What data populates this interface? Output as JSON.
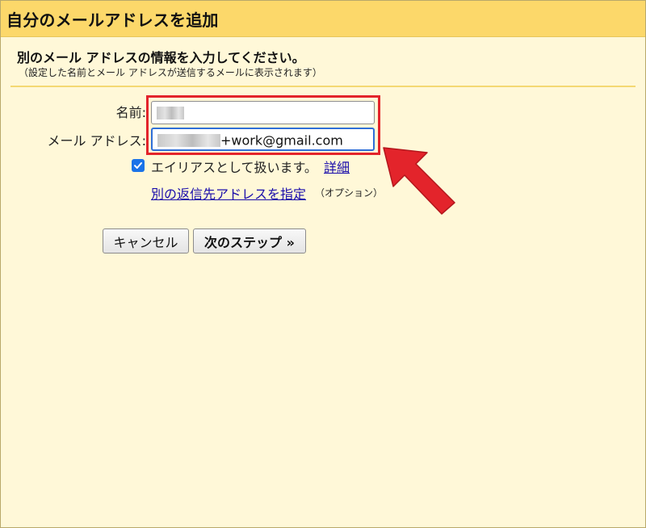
{
  "window": {
    "title": "自分のメールアドレスを追加"
  },
  "form": {
    "heading": "別のメール アドレスの情報を入力してください。",
    "subnote": "（設定した名前とメール アドレスが送信するメールに表示されます）",
    "name_label": "名前:",
    "email_label": "メール アドレス:",
    "email_value_suffix": "+work@gmail.com",
    "alias_checkbox": {
      "checked": true,
      "label": "エイリアスとして扱います。"
    },
    "detail_link": "詳細",
    "reply_link": "別の返信先アドレスを指定",
    "reply_option_note": "（オプション）"
  },
  "buttons": {
    "cancel_label": "キャンセル",
    "next_label": "次のステップ »"
  },
  "colors": {
    "title_bar": "#fcd86a",
    "background": "#fff8d8",
    "highlight": "#e3242b",
    "link": "#1a0dab",
    "checkbox": "#1a73e8"
  }
}
